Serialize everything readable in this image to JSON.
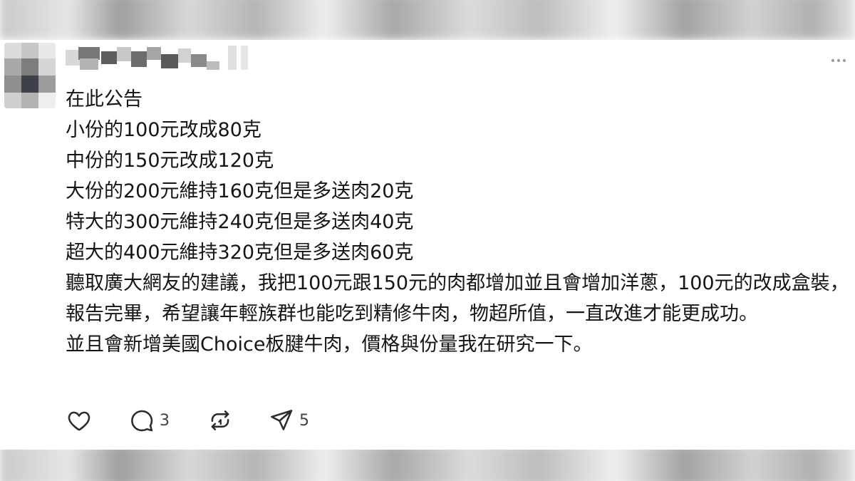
{
  "post": {
    "lines": [
      "在此公告",
      "小份的100元改成80克",
      "中份的150元改成120克",
      "大份的200元維持160克但是多送肉20克",
      "特大的300元維持240克但是多送肉40克",
      "超大的400元維持320克但是多送肉60克",
      "聽取廣大網友的建議，我把100元跟150元的肉都增加並且會增加洋蔥，100元的改成盒裝，報告完畢，希望讓年輕族群也能吃到精修牛肉，物超所值，一直改進才能更成功。",
      "並且會新增美國Choice板腱牛肉，價格與份量我在研究一下。"
    ]
  },
  "actions": {
    "like_icon": "heart-icon",
    "reply_icon": "comment-icon",
    "reply_count": "3",
    "repost_icon": "repost-icon",
    "share_icon": "send-icon",
    "share_count": "5"
  },
  "header": {
    "more_icon": "more-options-icon"
  },
  "colors": {
    "text": "#151515",
    "icon": "#2b2b2b",
    "count": "#424242",
    "muted": "#9a9a9a"
  }
}
